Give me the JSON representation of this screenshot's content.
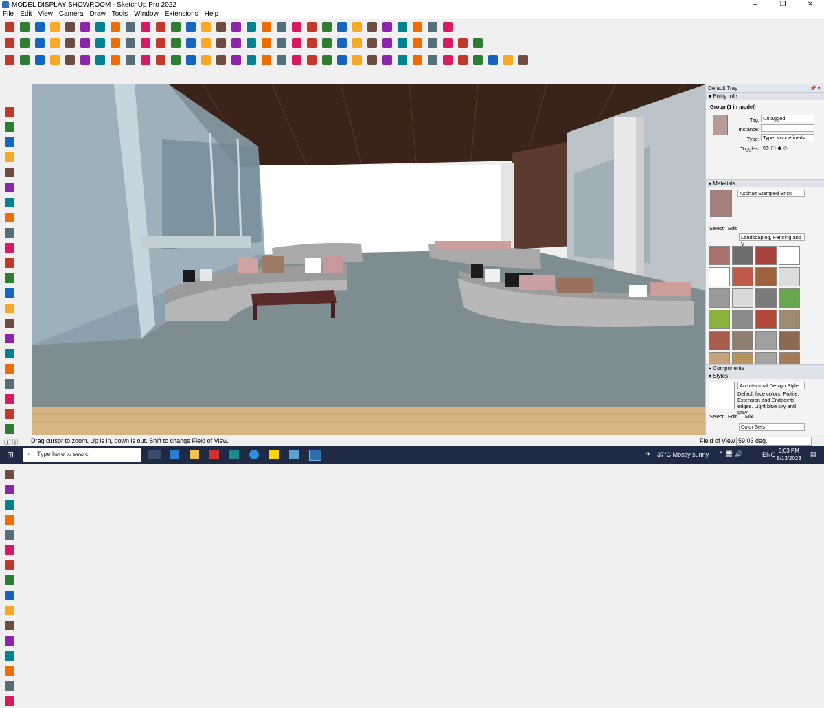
{
  "window": {
    "title": "MODEL DISPLAY SHOWROOM - SketchUp Pro 2022",
    "minimize": "–",
    "maximize": "❐",
    "close": "✕"
  },
  "menu": [
    "File",
    "Edit",
    "View",
    "Camera",
    "Draw",
    "Tools",
    "Window",
    "Extensions",
    "Help"
  ],
  "colors": {
    "accent": "#1565c0",
    "taskbar": "#1f2a44",
    "tray_header": "#e2e8ef"
  },
  "toolbars": {
    "row1_icons": [
      "zoom-icon",
      "select-icon",
      "eraser-icon",
      "line-icon",
      "arc-icon",
      "shapes-icon",
      "paint-icon",
      "push-pull-icon",
      "move-icon",
      "rotate-icon",
      "scale-icon",
      "offset-icon",
      "tape-icon",
      "text-icon",
      "axes-icon",
      "protractor-icon",
      "orbit-icon",
      "pan-icon",
      "zoom-window-icon",
      "zoom-extents-icon",
      "follow-me-icon",
      "intersect-icon",
      "sandbox-icon",
      "account-icon",
      "warehouse-icon",
      "extension-icon",
      "section-icon",
      "undo-icon",
      "redo-icon",
      "send-icon"
    ],
    "row2_icons": [
      "component-icon",
      "group-icon",
      "views-icon",
      "iso-icon",
      "top-icon",
      "front-icon",
      "right-icon",
      "back-icon",
      "left-icon",
      "xray-icon",
      "wireframe-icon",
      "hidden-line-icon",
      "shaded-icon",
      "textured-icon",
      "monochrome-icon",
      "house-icon",
      "camera-icon",
      "walk-icon",
      "look-icon",
      "position-icon",
      "styles-icon",
      "layers-icon",
      "solid-icon",
      "outer-shell-icon",
      "union-icon",
      "subtract-icon",
      "trim-icon",
      "split-icon",
      "materials-icon",
      "fog-icon",
      "shadows-icon",
      "sun-icon"
    ],
    "row3_icons": [
      "box-icon",
      "cylinder-icon",
      "cone-icon",
      "sphere-icon",
      "tube-icon",
      "arrow-icon",
      "grid-icon",
      "curve-icon",
      "spline-icon",
      "loft-icon",
      "extrude-icon",
      "sweep-icon",
      "bend-icon",
      "shear-icon",
      "twist-icon",
      "taper-icon",
      "flip-icon",
      "mirror-icon",
      "array-icon",
      "align-icon",
      "stair-icon",
      "wall-icon",
      "door-icon",
      "window-icon",
      "roof-icon",
      "floor-icon",
      "column-icon",
      "beam-icon",
      "label-icon",
      "dimension-icon",
      "sketch-icon",
      "edit-icon",
      "soften-icon",
      "weld-icon",
      "scale-tool-icon"
    ],
    "left_icons": [
      "select-icon",
      "eraser-icon",
      "paint-icon",
      "lasso-icon",
      "components-icon",
      "pencil-icon",
      "line-icon",
      "freehand-icon",
      "rectangle-icon",
      "rotated-rect-icon",
      "circle-icon",
      "polygon-icon",
      "arc-icon",
      "pie-icon",
      "two-point-arc-icon",
      "three-point-arc-icon",
      "move-icon",
      "push-pull-icon",
      "rotate-icon",
      "follow-me-icon",
      "scale-icon",
      "offset-icon",
      "tape-measure-icon",
      "dimension-icon",
      "protractor-icon",
      "text-icon",
      "axes-icon",
      "3d-text-icon",
      "orbit-icon",
      "pan-icon",
      "zoom-icon",
      "zoom-window-icon",
      "zoom-extents-icon",
      "previous-view-icon",
      "position-camera-icon",
      "look-around-icon",
      "walk-icon",
      "section-plane-icon",
      "display-section-icon",
      "section-cuts-icon"
    ]
  },
  "tray": {
    "title": "Default Tray",
    "entity_info": {
      "header": "Entity Info",
      "selection": "Group (1 in model)",
      "tag_label": "Tag:",
      "tag_value": "Untagged",
      "instance_label": "Instance:",
      "instance_value": "",
      "type_label": "Type:",
      "type_value": "Type: <undefined>",
      "toggles_label": "Toggles:"
    },
    "materials": {
      "header": "Materials",
      "current": "Asphalt Stamped Brick",
      "tab_select": "Select",
      "tab_edit": "Edit",
      "collection": "Landscaping, Fencing and V"
    },
    "components": {
      "header": "Components"
    },
    "styles": {
      "header": "Styles",
      "name": "Architectural Design Style",
      "description": "Default face colors. Profile, Extension and Endpoints edges. Light blue sky and gray",
      "tab_select": "Select",
      "tab_edit": "Edit",
      "tab_mix": "Mix",
      "collection": "Color Sets"
    }
  },
  "status": {
    "message": "Drag cursor to zoom.  Up is in, down is out. Shift to change Field of View.",
    "measure_label": "Field of View",
    "measure_value": "59.03 deg."
  },
  "taskbar": {
    "search_placeholder": "Type here to search",
    "weather": "37°C  Mostly sunny",
    "language": "ENG",
    "time": "3:03 PM",
    "date": "8/13/2023"
  }
}
